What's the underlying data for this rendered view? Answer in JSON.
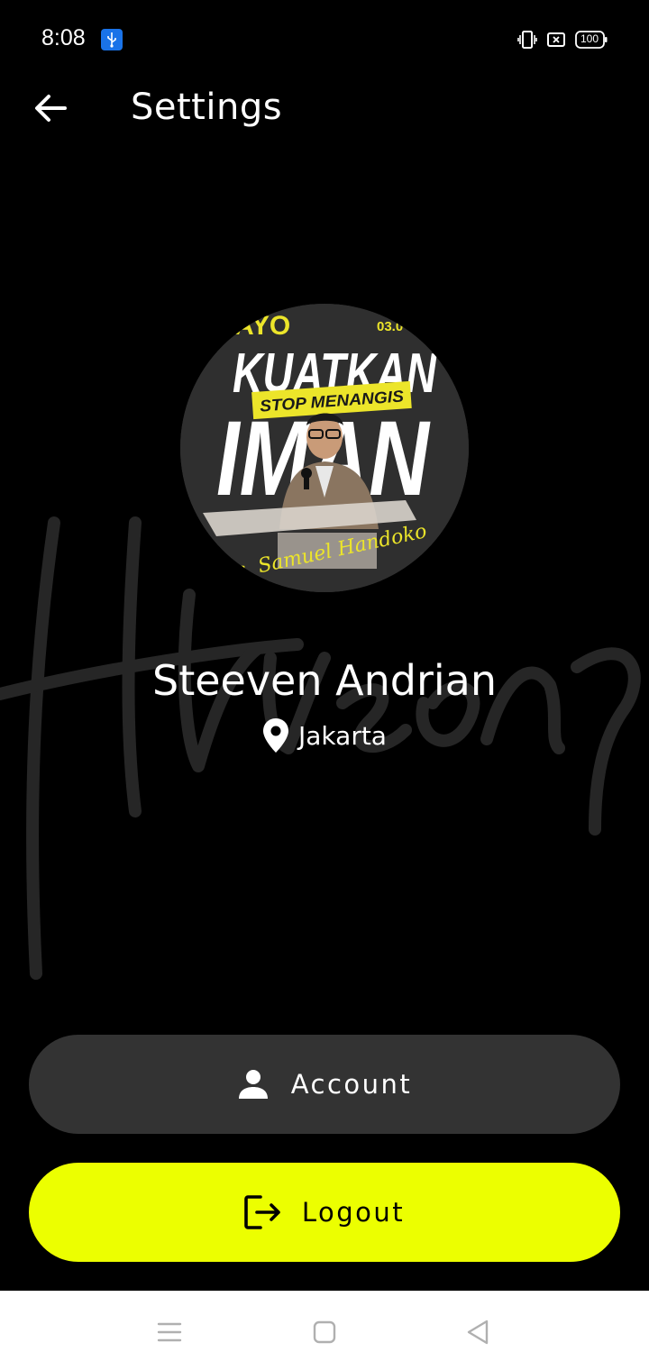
{
  "status_bar": {
    "time": "8:08",
    "battery": "100",
    "icons": [
      "usb-icon",
      "vibrate-icon",
      "sim-icon",
      "battery-icon"
    ]
  },
  "app_bar": {
    "title": "Settings",
    "back_icon": "arrow-left-icon"
  },
  "avatar": {
    "poster_text": {
      "line1": "AYO",
      "date": "03.0",
      "line2": "KUATKAN",
      "banner": "STOP MENANGIS",
      "line3": "IMAN",
      "signature": "Ps. Samuel Handoko"
    }
  },
  "profile": {
    "name": "Steeven Andrian",
    "location": "Jakarta",
    "location_icon": "location-pin-icon"
  },
  "buttons": {
    "account": {
      "label": "Account",
      "icon": "person-icon"
    },
    "logout": {
      "label": "Logout",
      "icon": "logout-icon"
    }
  },
  "colors": {
    "background": "#000000",
    "accent": "#ECFF00",
    "account_button": "#333333",
    "nav_bar": "#FFFFFF"
  },
  "nav_bar": {
    "icons": [
      "menu-icon",
      "home-square-icon",
      "back-triangle-icon"
    ]
  }
}
